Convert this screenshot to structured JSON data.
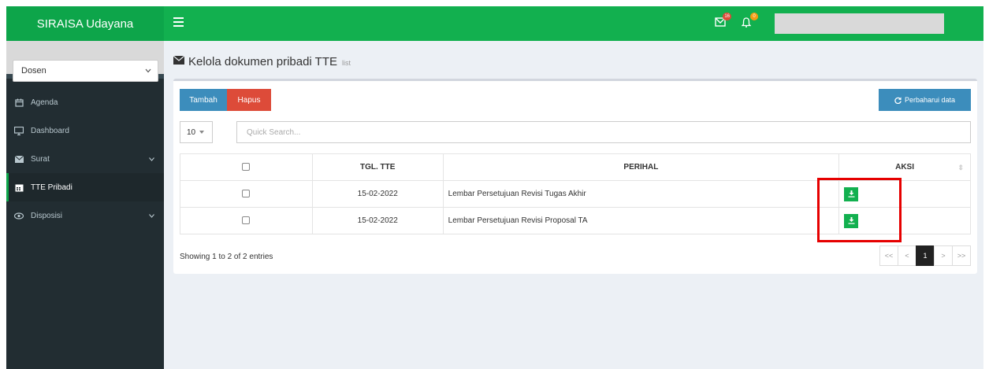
{
  "brand": {
    "title": "SIRAISA Udayana",
    "color": "#0da54a"
  },
  "navbar": {
    "color": "#12b04f",
    "mail_badge": "16",
    "notif_badge": "0",
    "icons": [
      "hamburger-icon",
      "envelope-icon",
      "bell-icon"
    ]
  },
  "sidebar": {
    "role_select": {
      "selected": "Dosen"
    },
    "items": [
      {
        "label": "Agenda",
        "icon": "calendar-icon",
        "active": false,
        "has_children": false
      },
      {
        "label": "Dashboard",
        "icon": "monitor-icon",
        "active": false,
        "has_children": false
      },
      {
        "label": "Surat",
        "icon": "envelope-icon",
        "active": false,
        "has_children": true
      },
      {
        "label": "TTE Pribadi",
        "icon": "calendar-icon",
        "active": true,
        "has_children": false
      },
      {
        "label": "Disposisi",
        "icon": "eye-icon",
        "active": false,
        "has_children": true
      }
    ]
  },
  "page": {
    "title": "Kelola dokumen pribadi TTE",
    "subtitle": "list",
    "icon": "envelope-icon"
  },
  "toolbar": {
    "add_label": "Tambah",
    "delete_label": "Hapus",
    "refresh_label": "Perbaharui data"
  },
  "table": {
    "length": "10",
    "search_placeholder": "Quick Search...",
    "headers": [
      "",
      "TGL. TTE",
      "PERIHAL",
      "AKSI"
    ],
    "rows": [
      {
        "date": "15-02-2022",
        "subject": "Lembar Persetujuan Revisi Tugas Akhir"
      },
      {
        "date": "15-02-2022",
        "subject": "Lembar Persetujuan Revisi Proposal TA"
      }
    ],
    "info": "Showing 1 to 2 of 2 entries",
    "pagination": [
      "<<",
      "<",
      "1",
      ">",
      ">>"
    ],
    "current_page": "1"
  },
  "colors": {
    "primary": "#3c8dbc",
    "danger": "#dd4b39",
    "success": "#12b04f",
    "highlight": "#e60000"
  }
}
